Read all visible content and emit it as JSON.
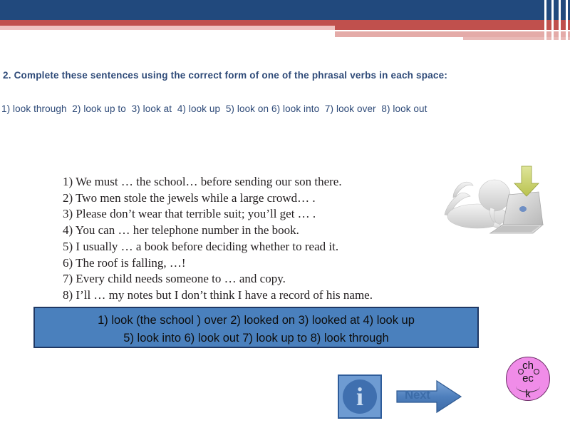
{
  "header": {
    "navy_color": "#21497D",
    "red_color": "#C0504D",
    "pink_color": "#E4ABA8"
  },
  "prompt": {
    "text": "2. Complete these sentences using the correct form of one of the phrasal verbs in each space:"
  },
  "verbs_line": {
    "items": [
      "1) look through",
      "2) look up to",
      "3) look at",
      "4) look up",
      "5) look on",
      "6) look into",
      "7) look over",
      "8) look out"
    ]
  },
  "sentences": [
    "1) We must … the school… before sending our son there.",
    "2) Two men stole the jewels while a large crowd… .",
    "3) Please don’t wear that terrible suit; you’ll get … .",
    "4) You can … her telephone number in the book.",
    "5) I usually … a book before deciding whether to read it.",
    "6) The roof is falling, …!",
    "7) Every child needs someone to … and copy.",
    "8) I’ll … my notes but I don’t think I have a record of his name."
  ],
  "answers": {
    "line1": "1) look (the school ) over     2) looked on    3) looked at 4) look up",
    "line2": "5) look into    6) look out    7) look up to   8) look through",
    "fill_color": "#4A80BD",
    "border_color": "#1F3864"
  },
  "illustration": {
    "name": "person-lying-with-laptop-and-download-arrow",
    "arrow_color": "#C8CE78"
  },
  "controls": {
    "info_label": "i",
    "next_label": "Next",
    "check_top": "ch",
    "check_middle": "ec",
    "check_bottom": "k",
    "check_color": "#F08CE8"
  }
}
